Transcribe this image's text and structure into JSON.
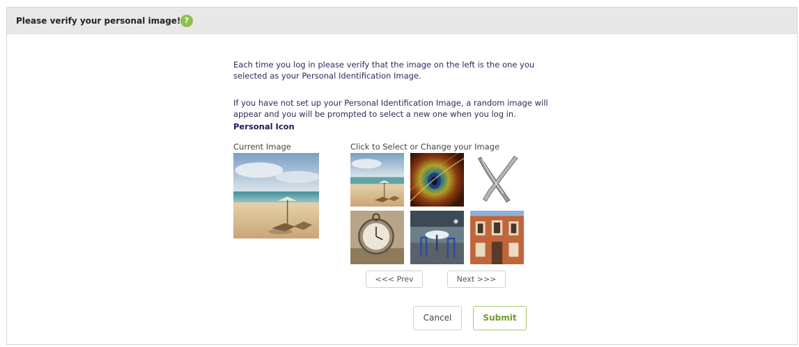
{
  "header": {
    "title": "Please verify your personal image!",
    "help_symbol": "?",
    "help_color": "#8cc04f"
  },
  "instructions": {
    "line1": "Each time you log in please verify that the image on the left is the one you",
    "line2": "selected as your Personal Identification Image.",
    "line3": "If you have not set up your Personal Identification Image, a random image will",
    "line4": "appear and you will be prompted to select a new one when you log in.",
    "personal_icon_label": "Personal Icon"
  },
  "current_image": {
    "label": "Current Image",
    "icon": "beach-umbrella-image"
  },
  "gallery": {
    "label": "Click to Select or Change your Image",
    "thumbnails": [
      {
        "icon": "beach-umbrella-image"
      },
      {
        "icon": "peacock-feather-image"
      },
      {
        "icon": "crossed-knives-image"
      },
      {
        "icon": "pocket-watch-image"
      },
      {
        "icon": "cafe-chairs-image"
      },
      {
        "icon": "old-building-image"
      }
    ],
    "prev_label": "<<< Prev",
    "next_label": "Next >>>"
  },
  "actions": {
    "cancel_label": "Cancel",
    "submit_label": "Submit",
    "submit_color": "#6a9e2a"
  }
}
